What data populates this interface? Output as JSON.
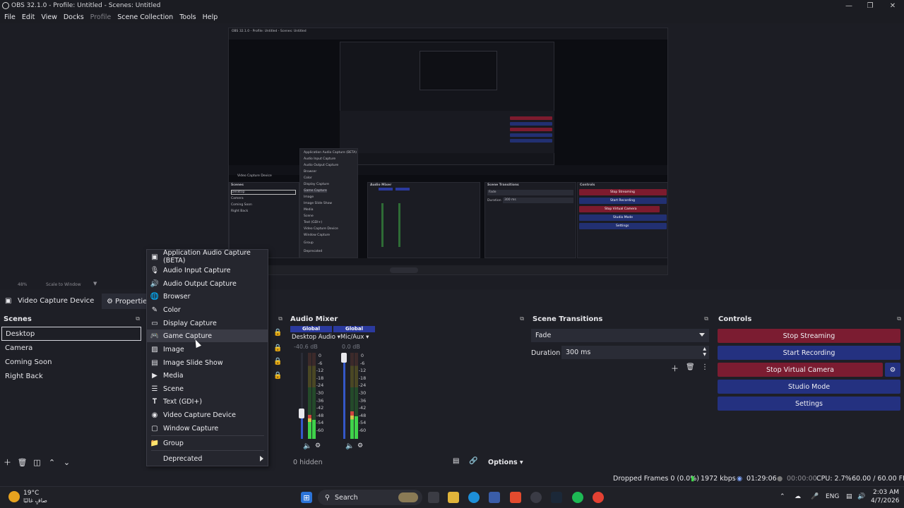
{
  "window": {
    "title": "OBS 32.1.0 - Profile: Untitled - Scenes: Untitled"
  },
  "menubar": [
    "File",
    "Edit",
    "View",
    "Docks",
    "Profile",
    "Scene Collection",
    "Tools",
    "Help"
  ],
  "scale": {
    "zoom": "48%",
    "mode": "Scale to Window"
  },
  "source_toolbar": {
    "source_name": "Video Capture Device",
    "properties": "Properties"
  },
  "scenes": {
    "title": "Scenes",
    "items": [
      "Desktop",
      "Camera",
      "Coming Soon",
      "Right Back"
    ],
    "selected": "Desktop"
  },
  "context_menu": {
    "items": [
      {
        "label": "Application Audio Capture (BETA)",
        "icon": "app-audio-icon"
      },
      {
        "label": "Audio Input Capture",
        "icon": "mic-icon"
      },
      {
        "label": "Audio Output Capture",
        "icon": "speaker-icon"
      },
      {
        "label": "Browser",
        "icon": "globe-icon"
      },
      {
        "label": "Color",
        "icon": "brush-icon"
      },
      {
        "label": "Display Capture",
        "icon": "monitor-icon"
      },
      {
        "label": "Game Capture",
        "icon": "gamepad-icon"
      },
      {
        "label": "Image",
        "icon": "image-icon"
      },
      {
        "label": "Image Slide Show",
        "icon": "slideshow-icon"
      },
      {
        "label": "Media",
        "icon": "play-icon"
      },
      {
        "label": "Scene",
        "icon": "list-icon"
      },
      {
        "label": "Text (GDI+)",
        "icon": "text-icon"
      },
      {
        "label": "Video Capture Device",
        "icon": "camera-icon"
      },
      {
        "label": "Window Capture",
        "icon": "window-icon"
      },
      {
        "label": "Group",
        "icon": "folder-icon"
      },
      {
        "label": "Deprecated",
        "icon": ""
      }
    ],
    "highlighted": "Game Capture"
  },
  "audio_mixer": {
    "title": "Audio Mixer",
    "channels": [
      {
        "tag": "Global",
        "name": "Desktop Audio",
        "db": "-40.6 dB",
        "level": 0.35,
        "volume": 0.28
      },
      {
        "tag": "Global",
        "name": "Mic/Aux",
        "db": "0.0 dB",
        "level": 0.3,
        "volume": 1.0
      }
    ],
    "ticks": [
      "0",
      "-6",
      "-12",
      "-18",
      "-24",
      "-30",
      "-36",
      "-42",
      "-48",
      "-54",
      "-60"
    ],
    "hidden": "0 hidden",
    "options": "Options"
  },
  "transitions": {
    "title": "Scene Transitions",
    "selected": "Fade",
    "duration_label": "Duration",
    "duration_value": "300 ms"
  },
  "controls": {
    "title": "Controls",
    "stop_streaming": "Stop Streaming",
    "start_recording": "Start Recording",
    "stop_virtual_camera": "Stop Virtual Camera",
    "studio_mode": "Studio Mode",
    "settings": "Settings"
  },
  "status": {
    "dropped": "Dropped Frames 0 (0.0%)",
    "kbps": "1972 kbps",
    "stream_time": "01:29:06",
    "rec_time": "00:00:00",
    "cpu": "CPU: 2.7%",
    "fps": "60.00 / 60.00 FPS"
  },
  "taskbar": {
    "weather_temp": "19°C",
    "weather_desc": "صافٍ غالبًا",
    "search": "Search",
    "lang": "ENG",
    "time": "2:03 AM",
    "date": "4/7/2026"
  },
  "nested": {
    "title": "OBS 32.1.0 - Profile: Untitled - Scenes: Untitled",
    "scenes": [
      "Desktop",
      "Camera",
      "Coming Soon",
      "Right Back"
    ],
    "menu": [
      "Application Audio Capture (BETA)",
      "Audio Input Capture",
      "Audio Output Capture",
      "Browser",
      "Color",
      "Display Capture",
      "Game Capture",
      "Image",
      "Image Slide Show",
      "Media",
      "Scene",
      "Text (GDI+)",
      "Video Capture Device",
      "Window Capture",
      "Group",
      "Deprecated"
    ],
    "controls": [
      "Stop Streaming",
      "Start Recording",
      "Stop Virtual Camera",
      "Studio Mode",
      "Settings"
    ]
  },
  "colors": {
    "accent_blue": "#243180",
    "accent_red": "#7b1c31",
    "meter_green": "#3fd34a"
  }
}
